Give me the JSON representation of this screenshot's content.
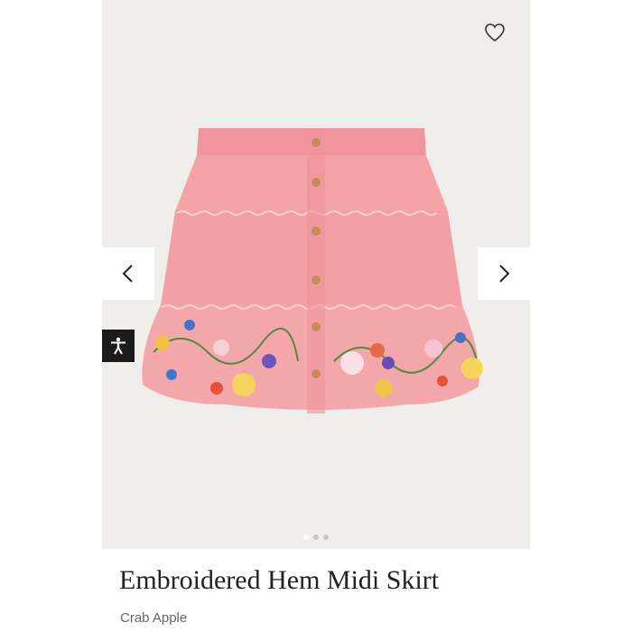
{
  "product": {
    "title": "Embroidered Hem Midi Skirt",
    "color_name": "Crab Apple"
  },
  "gallery": {
    "slide_count": 3,
    "active_slide": 1,
    "background_color": "#f0eeea",
    "icons": {
      "wishlist": "heart-outline-icon",
      "previous": "chevron-left-icon",
      "next": "chevron-right-icon",
      "accessibility": "accessibility-person-icon"
    }
  },
  "colors": {
    "skirt": "#f2a0a4",
    "skirt_shadow": "#e48d92",
    "buttons": "#c88a5a"
  }
}
